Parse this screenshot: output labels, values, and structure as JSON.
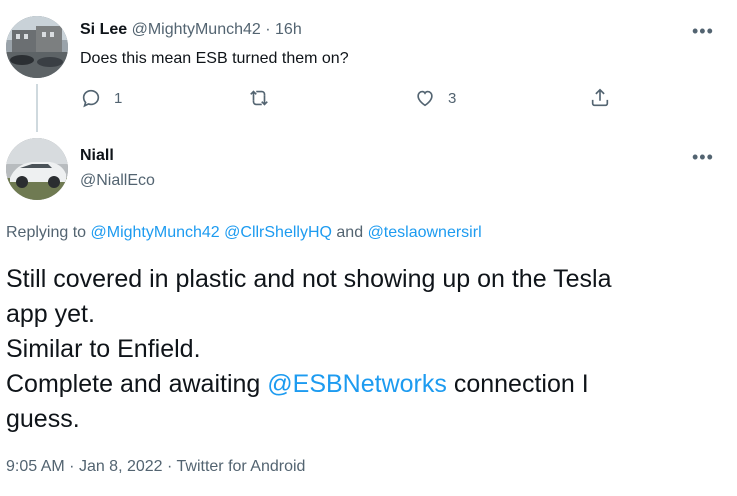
{
  "reply_tweet": {
    "name": "Si Lee",
    "handle": "@MightyMunch42",
    "separator": "·",
    "time": "16h",
    "text": "Does this mean ESB turned them on?",
    "more": "•••",
    "actions": {
      "reply_count": "1",
      "retweet_count": "",
      "like_count": "3"
    }
  },
  "main_tweet": {
    "name": "Niall",
    "handle": "@NiallEco",
    "more": "•••",
    "replying_prefix": "Replying to",
    "replying_user1": "@MightyMunch42",
    "replying_user2": "@CllrShellyHQ",
    "replying_and": "and",
    "replying_user3": "@teslaownersirl",
    "body_line1": "Still covered in plastic and not showing up on the Tesla",
    "body_line2": "app yet.",
    "body_line3": "Similar to Enfield.",
    "body_line4_pre": "Complete and awaiting",
    "body_mention": "@ESBNetworks",
    "body_line4_post": "connection I",
    "body_line5": "guess.",
    "meta_time": "9:05 AM",
    "meta_sep1": "·",
    "meta_date": "Jan 8, 2022",
    "meta_sep2": "·",
    "meta_source": "Twitter for Android"
  },
  "colors": {
    "link": "#1d9bf0",
    "muted": "#536471",
    "text": "#0f1419",
    "line": "#cfd9de"
  }
}
